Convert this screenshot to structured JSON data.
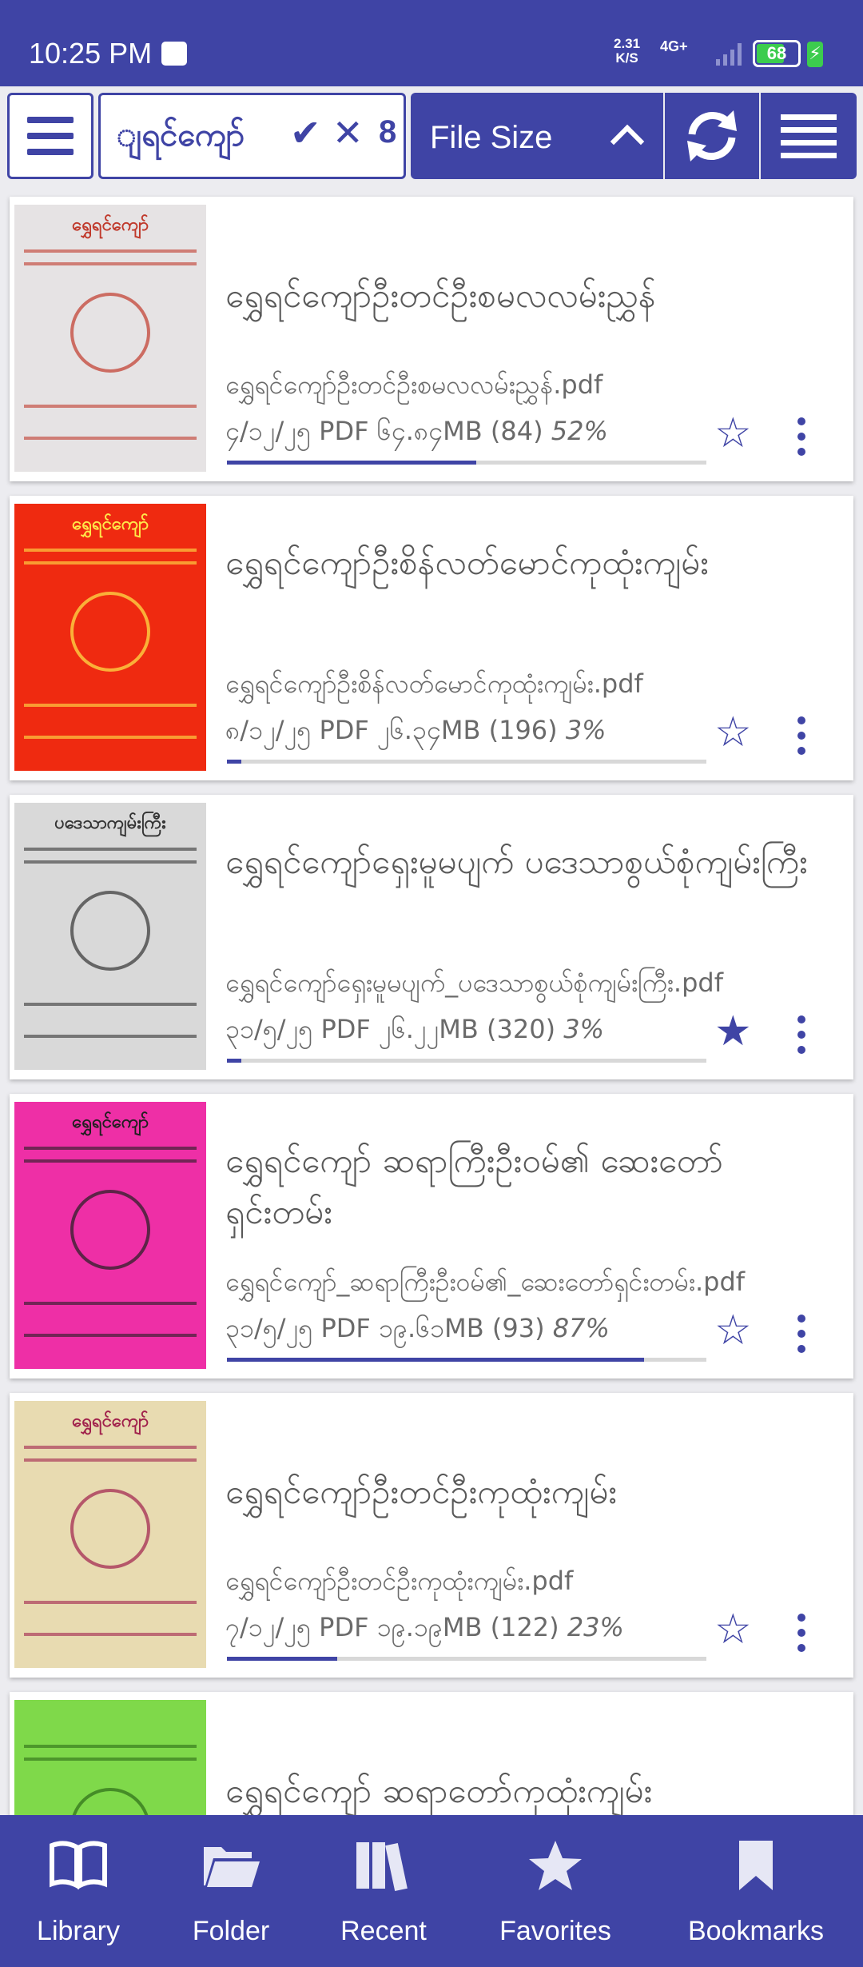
{
  "status": {
    "time": "10:25 PM",
    "speed_value": "2.31",
    "speed_unit": "K/S",
    "network": "4G+",
    "battery": "68"
  },
  "toolbar": {
    "search_text": "ျရင်ကျော်",
    "confirm_icon": "check-icon",
    "clear_icon": "close-icon",
    "result_count": "8",
    "sort_label": "File Size",
    "colors": {
      "primary": "#3f44a5"
    }
  },
  "books": [
    {
      "title": "ရွှေရင်ကျော်ဦးတင်ဦးစမလလမ်းညွှန်",
      "file": "ရွှေရင်ကျော်ဦးတင်ဦးစမလလမ်းညွှန်.pdf",
      "date": "၄/၁၂/၂၅",
      "type": "PDF",
      "size": "၆၄.၈၄MB",
      "pages": "(84)",
      "progress_text": "52%",
      "progress": 0.52,
      "favorite": false,
      "cover_title": "ရွှေရင်ကျော်",
      "cover_bg": "#e6e3e4",
      "cover_fg": "#c0392b"
    },
    {
      "title": "ရွှေရင်ကျော်ဦးစိန်လတ်မောင်ကုထုံးကျမ်း",
      "file": "ရွှေရင်ကျော်ဦးစိန်လတ်မောင်ကုထုံးကျမ်း.pdf",
      "date": "၈/၁၂/၂၅",
      "type": "PDF",
      "size": "၂၆.၃၄MB",
      "pages": "(196)",
      "progress_text": "3%",
      "progress": 0.03,
      "favorite": false,
      "cover_title": "ရွှေရင်ကျော်",
      "cover_bg": "#ef2a10",
      "cover_fg": "#ffe94a"
    },
    {
      "title": "ရွှေရင်ကျော်ရှေးမူမပျက် ပဒေသာစွယ်စုံကျမ်းကြီး",
      "file": "ရွှေရင်ကျော်ရှေးမူမပျက်_ပဒေသာစွယ်စုံကျမ်းကြီး.pdf",
      "date": "၃၁/၅/၂၅",
      "type": "PDF",
      "size": "၂၆.၂၂MB",
      "pages": "(320)",
      "progress_text": "3%",
      "progress": 0.03,
      "favorite": true,
      "cover_title": "ပဒေသာကျမ်းကြီး",
      "cover_bg": "#d9d9d9",
      "cover_fg": "#333333"
    },
    {
      "title": "ရွှေရင်ကျော် ဆရာကြီးဦးဝမ်၏ ဆေးတော်ရှင်းတမ်း",
      "file": "ရွှေရင်ကျော်_ဆရာကြီးဦးဝမ်၏_ဆေးတော်ရှင်းတမ်း.pdf",
      "date": "၃၁/၅/၂၅",
      "type": "PDF",
      "size": "၁၉.၆၁MB",
      "pages": "(93)",
      "progress_text": "87%",
      "progress": 0.87,
      "favorite": false,
      "cover_title": "ရွှေရင်ကျော်",
      "cover_bg": "#ee2fa6",
      "cover_fg": "#1f1f1f"
    },
    {
      "title": "ရွှေရင်ကျော်ဦးတင်ဦးကုထုံးကျမ်း",
      "file": "ရွှေရင်ကျော်ဦးတင်ဦးကုထုံးကျမ်း.pdf",
      "date": "၇/၁၂/၂၅",
      "type": "PDF",
      "size": "၁၉.၁၉MB",
      "pages": "(122)",
      "progress_text": "23%",
      "progress": 0.23,
      "favorite": false,
      "cover_title": "ရွှေရင်ကျော်",
      "cover_bg": "#e8dbb1",
      "cover_fg": "#a0204b"
    },
    {
      "title": "ရွှေရင်ကျော် ဆရာတော်ကုထုံးကျမ်း",
      "file": "",
      "date": "",
      "type": "",
      "size": "",
      "pages": "",
      "progress_text": "",
      "progress": 0,
      "favorite": false,
      "cover_title": "",
      "cover_bg": "#7fd94a",
      "cover_fg": "#2c6b18"
    }
  ],
  "nav": [
    {
      "label": "Library",
      "icon": "book-icon"
    },
    {
      "label": "Folder",
      "icon": "folder-icon"
    },
    {
      "label": "Recent",
      "icon": "books-icon"
    },
    {
      "label": "Favorites",
      "icon": "star-icon"
    },
    {
      "label": "Bookmarks",
      "icon": "bookmark-icon"
    }
  ]
}
